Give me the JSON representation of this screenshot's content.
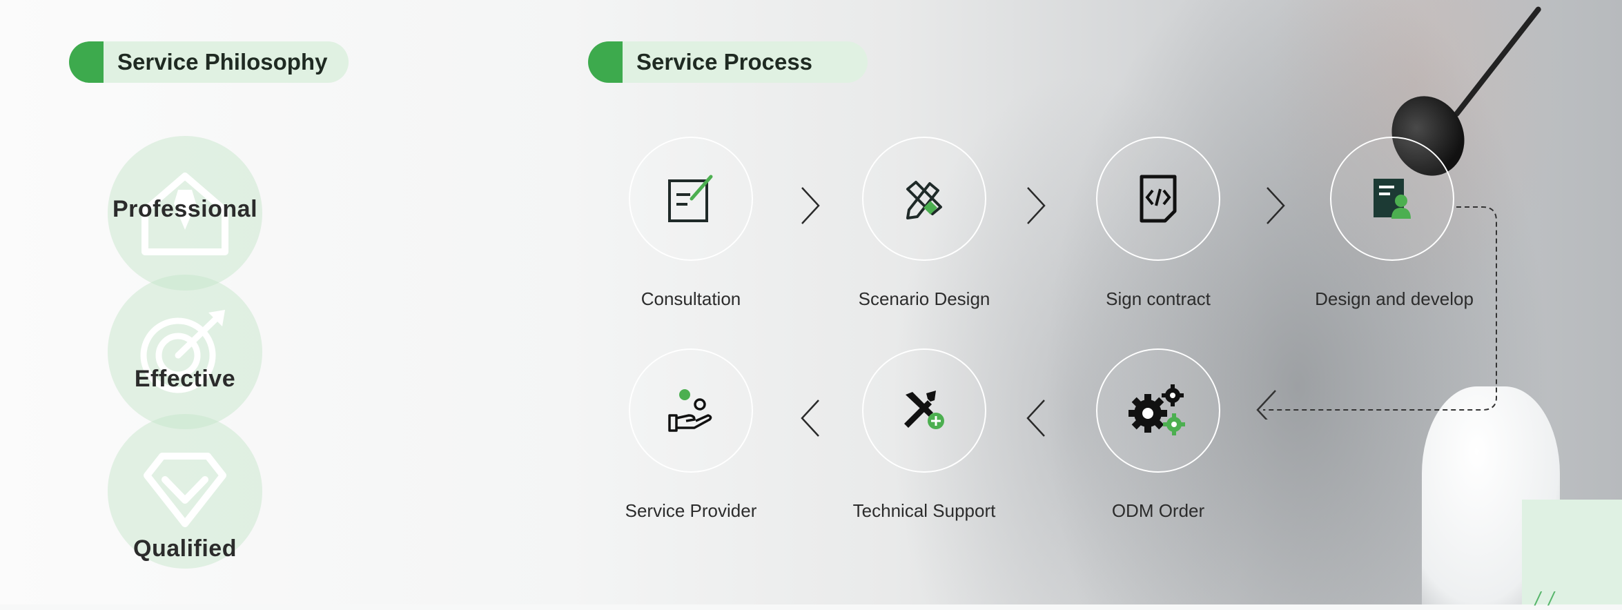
{
  "philosophy": {
    "title": "Service Philosophy",
    "items": [
      {
        "label": "Professional",
        "icon": "tie-shirt-icon"
      },
      {
        "label": "Effective",
        "icon": "target-arrow-icon"
      },
      {
        "label": "Qualified",
        "icon": "diamond-check-icon"
      }
    ]
  },
  "process": {
    "title": "Service Process",
    "steps": [
      {
        "label": "Consultation",
        "icon": "edit-note-icon"
      },
      {
        "label": "Scenario Design",
        "icon": "pen-ruler-icon"
      },
      {
        "label": "Sign contract",
        "icon": "code-document-icon"
      },
      {
        "label": "Design and develop",
        "icon": "developer-document-icon"
      },
      {
        "label": "ODM Order",
        "icon": "gears-icon"
      },
      {
        "label": "Technical Support",
        "icon": "tools-plus-icon"
      },
      {
        "label": "Service Provider",
        "icon": "hand-people-icon"
      }
    ]
  },
  "colors": {
    "accent": "#3daa4d",
    "accent_light": "#e0f1e2",
    "text": "#2c2c2c"
  }
}
